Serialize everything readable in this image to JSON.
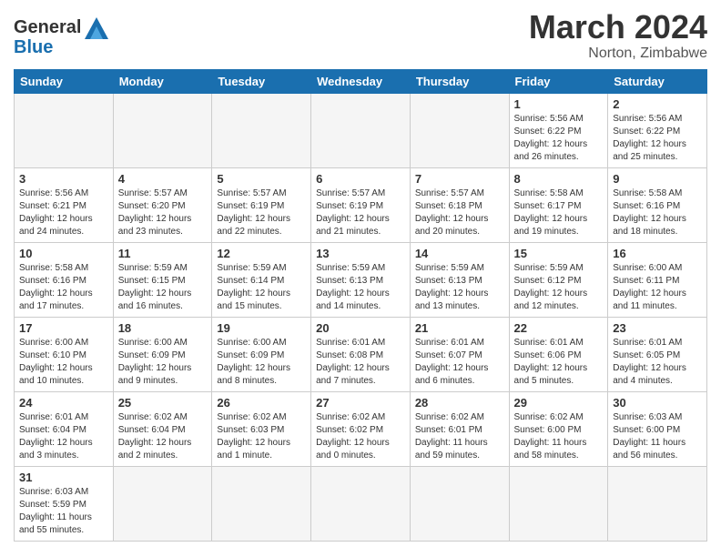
{
  "header": {
    "logo_general": "General",
    "logo_blue": "Blue",
    "month_title": "March 2024",
    "location": "Norton, Zimbabwe"
  },
  "weekdays": [
    "Sunday",
    "Monday",
    "Tuesday",
    "Wednesday",
    "Thursday",
    "Friday",
    "Saturday"
  ],
  "weeks": [
    [
      {
        "day": "",
        "info": "",
        "empty": true
      },
      {
        "day": "",
        "info": "",
        "empty": true
      },
      {
        "day": "",
        "info": "",
        "empty": true
      },
      {
        "day": "",
        "info": "",
        "empty": true
      },
      {
        "day": "",
        "info": "",
        "empty": true
      },
      {
        "day": "1",
        "info": "Sunrise: 5:56 AM\nSunset: 6:22 PM\nDaylight: 12 hours and 26 minutes.",
        "empty": false
      },
      {
        "day": "2",
        "info": "Sunrise: 5:56 AM\nSunset: 6:22 PM\nDaylight: 12 hours and 25 minutes.",
        "empty": false
      }
    ],
    [
      {
        "day": "3",
        "info": "Sunrise: 5:56 AM\nSunset: 6:21 PM\nDaylight: 12 hours and 24 minutes.",
        "empty": false
      },
      {
        "day": "4",
        "info": "Sunrise: 5:57 AM\nSunset: 6:20 PM\nDaylight: 12 hours and 23 minutes.",
        "empty": false
      },
      {
        "day": "5",
        "info": "Sunrise: 5:57 AM\nSunset: 6:19 PM\nDaylight: 12 hours and 22 minutes.",
        "empty": false
      },
      {
        "day": "6",
        "info": "Sunrise: 5:57 AM\nSunset: 6:19 PM\nDaylight: 12 hours and 21 minutes.",
        "empty": false
      },
      {
        "day": "7",
        "info": "Sunrise: 5:57 AM\nSunset: 6:18 PM\nDaylight: 12 hours and 20 minutes.",
        "empty": false
      },
      {
        "day": "8",
        "info": "Sunrise: 5:58 AM\nSunset: 6:17 PM\nDaylight: 12 hours and 19 minutes.",
        "empty": false
      },
      {
        "day": "9",
        "info": "Sunrise: 5:58 AM\nSunset: 6:16 PM\nDaylight: 12 hours and 18 minutes.",
        "empty": false
      }
    ],
    [
      {
        "day": "10",
        "info": "Sunrise: 5:58 AM\nSunset: 6:16 PM\nDaylight: 12 hours and 17 minutes.",
        "empty": false
      },
      {
        "day": "11",
        "info": "Sunrise: 5:59 AM\nSunset: 6:15 PM\nDaylight: 12 hours and 16 minutes.",
        "empty": false
      },
      {
        "day": "12",
        "info": "Sunrise: 5:59 AM\nSunset: 6:14 PM\nDaylight: 12 hours and 15 minutes.",
        "empty": false
      },
      {
        "day": "13",
        "info": "Sunrise: 5:59 AM\nSunset: 6:13 PM\nDaylight: 12 hours and 14 minutes.",
        "empty": false
      },
      {
        "day": "14",
        "info": "Sunrise: 5:59 AM\nSunset: 6:13 PM\nDaylight: 12 hours and 13 minutes.",
        "empty": false
      },
      {
        "day": "15",
        "info": "Sunrise: 5:59 AM\nSunset: 6:12 PM\nDaylight: 12 hours and 12 minutes.",
        "empty": false
      },
      {
        "day": "16",
        "info": "Sunrise: 6:00 AM\nSunset: 6:11 PM\nDaylight: 12 hours and 11 minutes.",
        "empty": false
      }
    ],
    [
      {
        "day": "17",
        "info": "Sunrise: 6:00 AM\nSunset: 6:10 PM\nDaylight: 12 hours and 10 minutes.",
        "empty": false
      },
      {
        "day": "18",
        "info": "Sunrise: 6:00 AM\nSunset: 6:09 PM\nDaylight: 12 hours and 9 minutes.",
        "empty": false
      },
      {
        "day": "19",
        "info": "Sunrise: 6:00 AM\nSunset: 6:09 PM\nDaylight: 12 hours and 8 minutes.",
        "empty": false
      },
      {
        "day": "20",
        "info": "Sunrise: 6:01 AM\nSunset: 6:08 PM\nDaylight: 12 hours and 7 minutes.",
        "empty": false
      },
      {
        "day": "21",
        "info": "Sunrise: 6:01 AM\nSunset: 6:07 PM\nDaylight: 12 hours and 6 minutes.",
        "empty": false
      },
      {
        "day": "22",
        "info": "Sunrise: 6:01 AM\nSunset: 6:06 PM\nDaylight: 12 hours and 5 minutes.",
        "empty": false
      },
      {
        "day": "23",
        "info": "Sunrise: 6:01 AM\nSunset: 6:05 PM\nDaylight: 12 hours and 4 minutes.",
        "empty": false
      }
    ],
    [
      {
        "day": "24",
        "info": "Sunrise: 6:01 AM\nSunset: 6:04 PM\nDaylight: 12 hours and 3 minutes.",
        "empty": false
      },
      {
        "day": "25",
        "info": "Sunrise: 6:02 AM\nSunset: 6:04 PM\nDaylight: 12 hours and 2 minutes.",
        "empty": false
      },
      {
        "day": "26",
        "info": "Sunrise: 6:02 AM\nSunset: 6:03 PM\nDaylight: 12 hours and 1 minute.",
        "empty": false
      },
      {
        "day": "27",
        "info": "Sunrise: 6:02 AM\nSunset: 6:02 PM\nDaylight: 12 hours and 0 minutes.",
        "empty": false
      },
      {
        "day": "28",
        "info": "Sunrise: 6:02 AM\nSunset: 6:01 PM\nDaylight: 11 hours and 59 minutes.",
        "empty": false
      },
      {
        "day": "29",
        "info": "Sunrise: 6:02 AM\nSunset: 6:00 PM\nDaylight: 11 hours and 58 minutes.",
        "empty": false
      },
      {
        "day": "30",
        "info": "Sunrise: 6:03 AM\nSunset: 6:00 PM\nDaylight: 11 hours and 56 minutes.",
        "empty": false
      }
    ],
    [
      {
        "day": "31",
        "info": "Sunrise: 6:03 AM\nSunset: 5:59 PM\nDaylight: 11 hours and 55 minutes.",
        "empty": false
      },
      {
        "day": "",
        "info": "",
        "empty": true
      },
      {
        "day": "",
        "info": "",
        "empty": true
      },
      {
        "day": "",
        "info": "",
        "empty": true
      },
      {
        "day": "",
        "info": "",
        "empty": true
      },
      {
        "day": "",
        "info": "",
        "empty": true
      },
      {
        "day": "",
        "info": "",
        "empty": true
      }
    ]
  ]
}
